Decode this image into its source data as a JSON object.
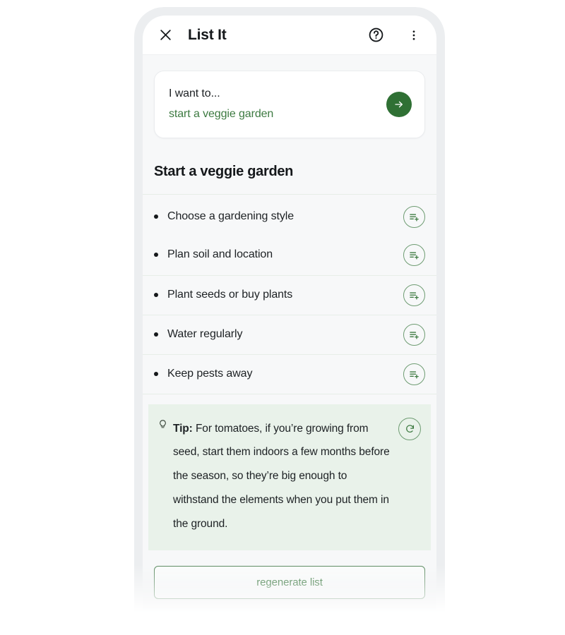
{
  "appbar": {
    "close_icon": "close-icon",
    "title": "List It",
    "help_icon": "help-circle-icon",
    "more_icon": "more-vertical-icon"
  },
  "prompt": {
    "label": "I want to...",
    "value": "start a veggie garden",
    "submit_icon": "arrow-right-icon"
  },
  "result": {
    "title": "Start a veggie garden",
    "items": [
      {
        "text": "Choose a gardening style",
        "action_icon": "playlist-add-icon"
      },
      {
        "text": "Plan soil and location",
        "action_icon": "playlist-add-icon"
      },
      {
        "text": "Plant seeds or buy plants",
        "action_icon": "playlist-add-icon"
      },
      {
        "text": "Water regularly",
        "action_icon": "playlist-add-icon"
      },
      {
        "text": "Keep pests away",
        "action_icon": "playlist-add-icon"
      }
    ]
  },
  "tip": {
    "icon": "lightbulb-icon",
    "prefix": "Tip:",
    "body": "For tomatoes, if you’re growing from seed, start them indoors a few months before the season, so they’re big enough to withstand the elements when you put them in the ground.",
    "refresh_icon": "refresh-icon"
  },
  "footer": {
    "regenerate_label": "regenerate list"
  },
  "colors": {
    "accent_green": "#2f7034",
    "link_green": "#3d7a41",
    "outline_green": "#6e9c72",
    "tip_bg": "#e9f2ea",
    "screen_bg": "#f7f8f9",
    "bezel": "#eceef0",
    "text": "#1d2124"
  }
}
